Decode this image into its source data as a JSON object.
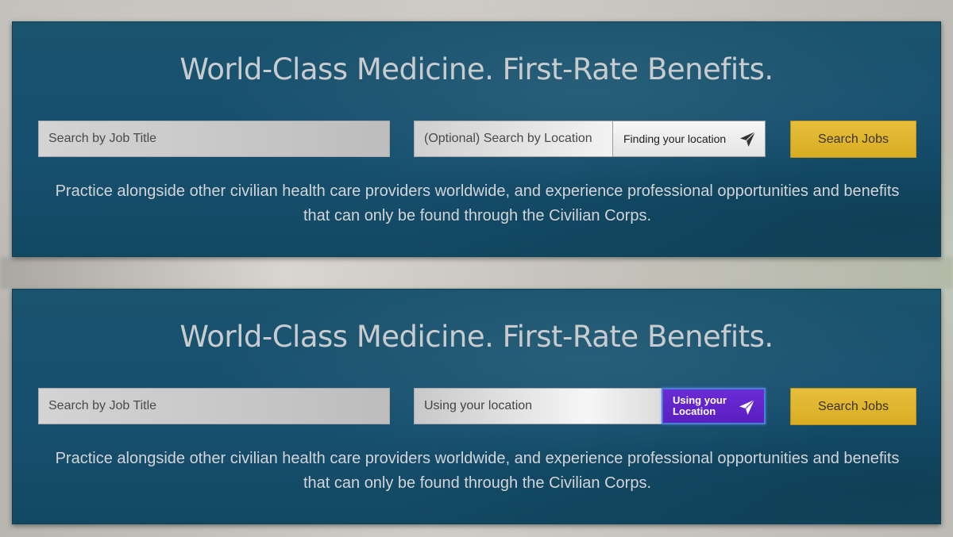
{
  "panels": [
    {
      "headline": "World-Class Medicine. First-Rate Benefits.",
      "job_input": {
        "placeholder": "Search by Job Title",
        "value": ""
      },
      "location_input": {
        "placeholder": "(Optional) Search by Location",
        "value": ""
      },
      "location_button": {
        "label": "Finding your location",
        "icon": "navigation-arrow-icon",
        "state": "finding"
      },
      "search_button": {
        "label": "Search Jobs"
      },
      "tagline": "Practice alongside other civilian health care providers worldwide, and experience professional opportunities and benefits that can only be found through the Civilian Corps."
    },
    {
      "headline": "World-Class Medicine. First-Rate Benefits.",
      "job_input": {
        "placeholder": "Search by Job Title",
        "value": ""
      },
      "location_input": {
        "placeholder": "",
        "value": "Using your location"
      },
      "location_button": {
        "label": "Using your Location",
        "icon": "navigation-arrow-icon",
        "state": "active"
      },
      "search_button": {
        "label": "Search Jobs"
      },
      "tagline": "Practice alongside other civilian health care providers worldwide, and experience professional opportunities and benefits that can only be found through the Civilian Corps."
    }
  ],
  "colors": {
    "panel_bg": "#175070",
    "search_button": "#e2b630",
    "location_button_active": "#6426cc",
    "headline": "#c9cccf"
  }
}
